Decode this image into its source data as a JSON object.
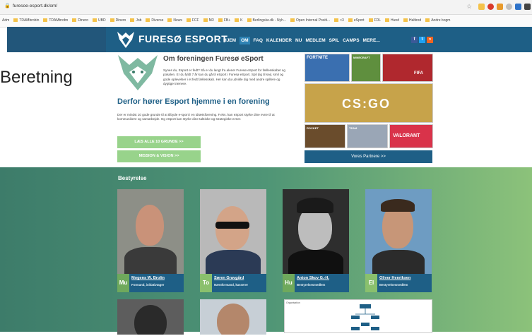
{
  "browser": {
    "url": "furesoe-esport.dk/om/",
    "bookmarks": [
      "Adm",
      "TDAMbrobin",
      "TDAMbrobn",
      "Dinero",
      "UBD",
      "Dinero",
      "Job",
      "Diverse",
      "News",
      "FCF",
      "NR",
      "FB+",
      "K",
      "Berlingske.dk - Nyh...",
      "Open Internal Positi...",
      "<3",
      "eSport",
      "FDL",
      "Hund",
      "Haltired",
      "Andre bogm"
    ]
  },
  "header": {
    "logo_text": "FURESØ ESPORT",
    "nav": [
      "HJEM",
      "OM",
      "FAQ",
      "KALENDER",
      "NU",
      "MEDLEM",
      "SPIL",
      "CAMPS",
      "MERE..."
    ],
    "active_nav": "OM",
    "social": [
      "f",
      "t",
      "rss"
    ]
  },
  "overlay_text": "Beretning",
  "about": {
    "title": "Om foreningen Furesø eSport",
    "body": "Synes du, Esport er fedt? Så er du langt fra alene! Furesø eSport for fællesskabet og pokalen. Er du fyldt 7 år kan du gå til eSport i Furesø eSport. Spil dig til sejr, smil og gode oplevelser i et fedt fællesskab. Her kan du udvikle dig med andre spillere og dygtige trænere."
  },
  "why": {
    "title": "Derfor hører Esport hjemme i en forening",
    "body": "Der er mindst 10 gode grunde til at tilbyde e-sport i en idrætsforening. F.eks. kan eSport styrke dine evne til at kommunikere og samarbejde. Og eSport kan styrke dine taktiske og strategiske evner.",
    "btn_grunde": "LÆS ALLE 10 GRUNDE >>",
    "btn_mission": "MISSION & VISION >>"
  },
  "games": [
    {
      "label": "FORTNITE",
      "color": "#3a6fb0"
    },
    {
      "label": "MINECRAFT",
      "color": "#5f8f3e"
    },
    {
      "label": "FIFA",
      "color": "#b0282e"
    },
    {
      "label": "CS:GO",
      "color": "#c7a34a"
    },
    {
      "label": "ROCKET",
      "color": "#6a4c2c"
    },
    {
      "label": "TEAM",
      "color": "#9aa6b6"
    },
    {
      "label": "VALORANT",
      "color": "#d9334a"
    }
  ],
  "partners_btn": "Vores Partnere >>",
  "board": {
    "title": "Bestyrelse",
    "members": [
      {
        "initials": "Mu",
        "name": "Mogens W. Brolin",
        "role": "Formand, initiativtager"
      },
      {
        "initials": "To",
        "name": "Søren Gravgård",
        "role": "Næstformand, kasserer"
      },
      {
        "initials": "Hu",
        "name": "Anton Skov G.-H.",
        "role": "Bestyrelsesmedlem"
      },
      {
        "initials": "El",
        "name": "Oliver Henriksen",
        "role": "Bestyrelsesmedlem"
      }
    ],
    "org_title": "Organisation"
  },
  "colors": {
    "brand_blue": "#1e5f86",
    "button_green": "#98d38b",
    "initials_green": "#6fa95c"
  }
}
